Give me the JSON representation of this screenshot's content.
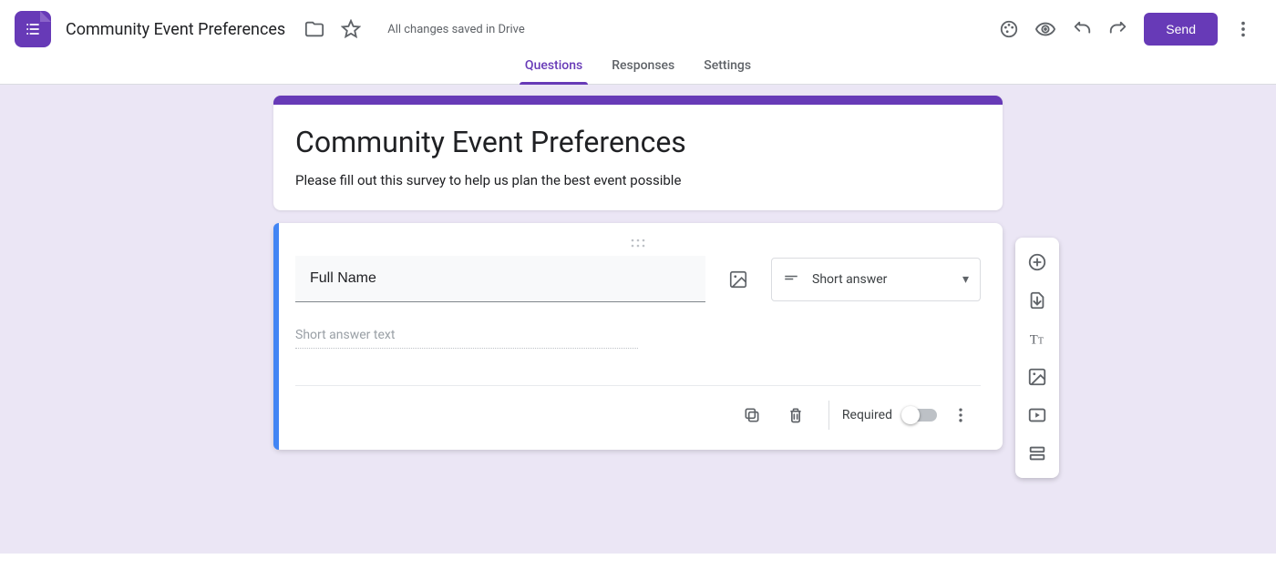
{
  "header": {
    "doc_title": "Community Event Preferences",
    "save_status": "All changes saved in Drive",
    "send_label": "Send"
  },
  "tabs": {
    "questions": "Questions",
    "responses": "Responses",
    "settings": "Settings",
    "active": "questions"
  },
  "form": {
    "title": "Community Event Preferences",
    "description": "Please fill out this survey to help us plan the best event possible"
  },
  "question": {
    "title_value": "Full Name",
    "type_label": "Short answer",
    "answer_placeholder": "Short answer text",
    "required_label": "Required",
    "required": false
  },
  "side_toolbar": {
    "items": [
      "add-question",
      "import-questions",
      "add-title",
      "add-image",
      "add-video",
      "add-section"
    ]
  },
  "colors": {
    "accent": "#673ab7",
    "selected": "#4285f4"
  }
}
